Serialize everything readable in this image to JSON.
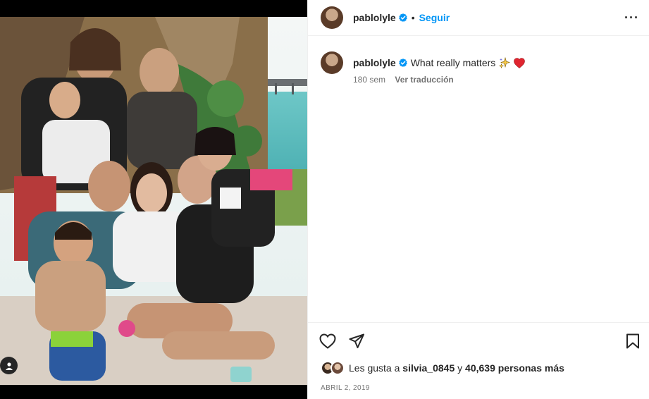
{
  "post": {
    "username": "pablolyle",
    "follow_label": "Seguir",
    "dot": "•",
    "more_label": "···",
    "caption": "What really matters",
    "caption_emojis": [
      "sparkles-emoji",
      "red-heart-emoji"
    ],
    "age": "180 sem",
    "translate_label": "Ver traducción",
    "likes_prefix": "Les gusta a ",
    "liker": "silvia_0845",
    "likes_mid": " y ",
    "likes_count": "40,639 personas más",
    "date": "ABRIL 2, 2019"
  },
  "icons": {
    "verified": "verified-badge-icon",
    "like": "heart-outline-icon",
    "share": "send-icon",
    "save": "bookmark-icon",
    "tag": "person-tag-icon"
  },
  "colors": {
    "accent": "#0095f6",
    "verified": "#0095f6",
    "text": "#262626",
    "muted": "#737373",
    "heart": "#ed4956"
  }
}
